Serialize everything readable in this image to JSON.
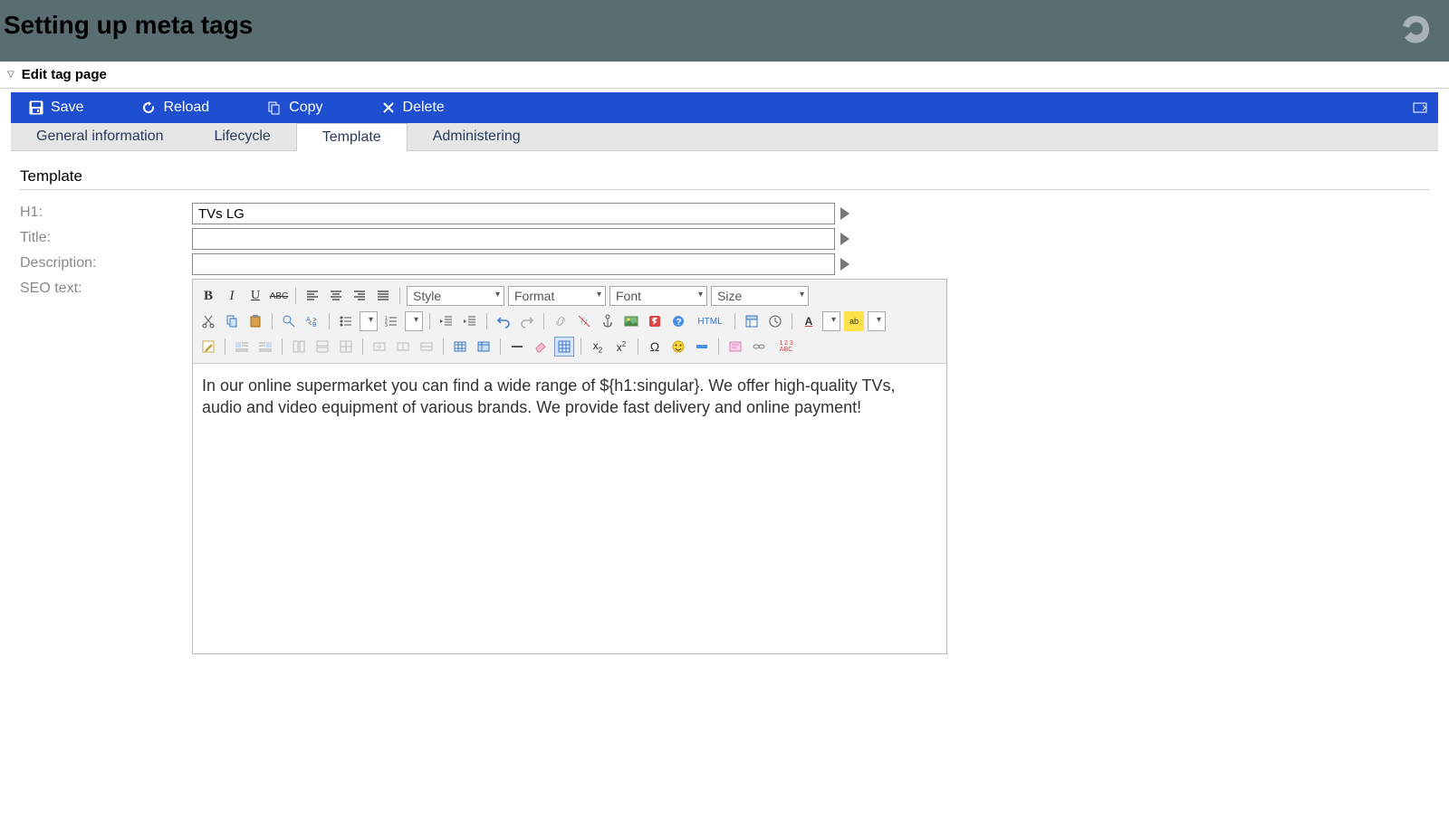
{
  "header": {
    "title": "Setting up meta tags"
  },
  "collapse": {
    "label": "Edit tag page"
  },
  "toolbar": {
    "save": "Save",
    "reload": "Reload",
    "copy": "Copy",
    "delete": "Delete"
  },
  "tabs": [
    {
      "label": "General information",
      "active": false
    },
    {
      "label": "Lifecycle",
      "active": false
    },
    {
      "label": "Template",
      "active": true
    },
    {
      "label": "Administering",
      "active": false
    }
  ],
  "section": {
    "title": "Template"
  },
  "form": {
    "h1_label": "H1:",
    "h1_value": "TVs LG",
    "title_label": "Title:",
    "title_value": "",
    "description_label": "Description:",
    "description_value": "",
    "seo_label": "SEO text:"
  },
  "editor_selects": {
    "style": "Style",
    "format": "Format",
    "font": "Font",
    "size": "Size"
  },
  "editor_labels": {
    "html": "HTML",
    "spellnum": "1 2 3",
    "spellabc": "ABC"
  },
  "seo_text": "In our online supermarket you can find a wide range of ${h1:singular}. We offer high-quality TVs, audio and video equipment of various brands. We provide fast delivery and online payment!"
}
